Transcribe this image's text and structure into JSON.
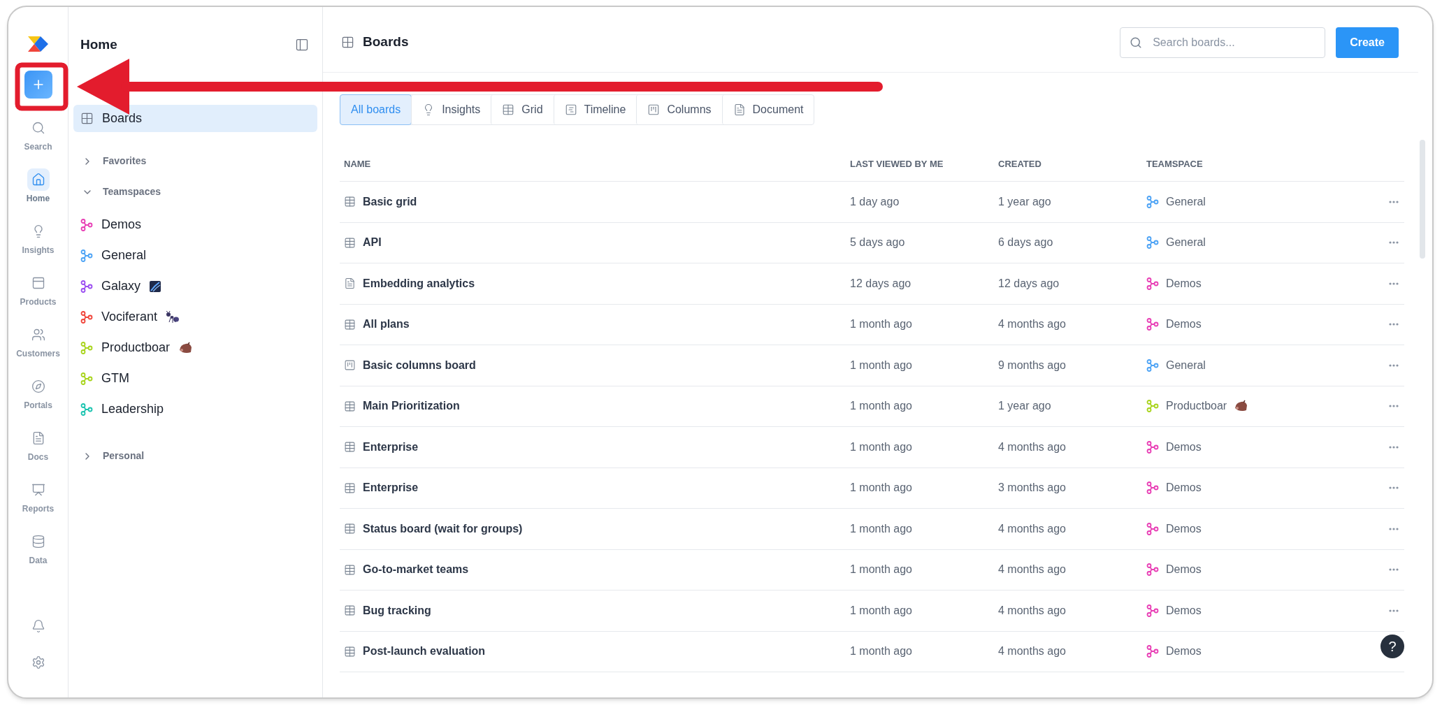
{
  "rail": {
    "items": [
      {
        "kind": "search",
        "label": "Search",
        "selected": false
      },
      {
        "kind": "home",
        "label": "Home",
        "selected": true
      },
      {
        "kind": "insights",
        "label": "Insights",
        "selected": false
      },
      {
        "kind": "products",
        "label": "Products",
        "selected": false
      },
      {
        "kind": "customers",
        "label": "Customers",
        "selected": false
      },
      {
        "kind": "portals",
        "label": "Portals",
        "selected": false
      },
      {
        "kind": "docs",
        "label": "Docs",
        "selected": false
      },
      {
        "kind": "reports",
        "label": "Reports",
        "selected": false
      },
      {
        "kind": "data",
        "label": "Data",
        "selected": false
      }
    ]
  },
  "sidebar": {
    "title": "Home",
    "items": [
      {
        "label": "Boards",
        "selected": true
      }
    ],
    "sections": [
      {
        "label": "Favorites",
        "expanded": false
      },
      {
        "label": "Teamspaces",
        "expanded": true,
        "children": [
          {
            "label": "Demos",
            "color": "#e83fb5"
          },
          {
            "label": "General",
            "color": "#4da3f5"
          },
          {
            "label": "Galaxy",
            "color": "#9b4df0",
            "kind": "galaxy"
          },
          {
            "label": "Vociferant",
            "color": "#f0453a",
            "kind": "ant"
          },
          {
            "label": "Productboar",
            "color": "#a8d41c",
            "kind": "boar"
          },
          {
            "label": "GTM",
            "color": "#a8d41c"
          },
          {
            "label": "Leadership",
            "color": "#1cc4b0"
          }
        ]
      },
      {
        "label": "Personal",
        "expanded": false
      }
    ]
  },
  "header": {
    "title": "Boards",
    "search": {
      "placeholder": "Search boards..."
    },
    "create_button": "Create"
  },
  "tabs": [
    {
      "kind": "all",
      "label": "All boards",
      "selected": true
    },
    {
      "kind": "insights",
      "label": "Insights",
      "selected": false
    },
    {
      "kind": "grid",
      "label": "Grid",
      "selected": false
    },
    {
      "kind": "timeline",
      "label": "Timeline",
      "selected": false
    },
    {
      "kind": "columns",
      "label": "Columns",
      "selected": false
    },
    {
      "kind": "document",
      "label": "Document",
      "selected": false
    }
  ],
  "table": {
    "columns": [
      "NAME",
      "LAST VIEWED BY ME",
      "CREATED",
      "TEAMSPACE"
    ],
    "rows": [
      {
        "kind": "grid",
        "name": "Basic grid",
        "last_viewed": "1 day ago",
        "created": "1 year ago",
        "teamspace": "General",
        "color": "#4da3f5"
      },
      {
        "kind": "grid",
        "name": "API",
        "last_viewed": "5 days ago",
        "created": "6 days ago",
        "teamspace": "General",
        "color": "#4da3f5"
      },
      {
        "kind": "document",
        "name": "Embedding analytics",
        "last_viewed": "12 days ago",
        "created": "12 days ago",
        "teamspace": "Demos",
        "color": "#e83fb5"
      },
      {
        "kind": "grid",
        "name": "All plans",
        "last_viewed": "1 month ago",
        "created": "4 months ago",
        "teamspace": "Demos",
        "color": "#e83fb5"
      },
      {
        "kind": "columns",
        "name": "Basic columns board",
        "last_viewed": "1 month ago",
        "created": "9 months ago",
        "teamspace": "General",
        "color": "#4da3f5"
      },
      {
        "kind": "grid",
        "name": "Main Prioritization",
        "last_viewed": "1 month ago",
        "created": "1 year ago",
        "teamspace": "Productboar",
        "color": "#a8d41c",
        "badge": {
          "kind": "boar"
        }
      },
      {
        "kind": "grid",
        "name": "Enterprise",
        "last_viewed": "1 month ago",
        "created": "4 months ago",
        "teamspace": "Demos",
        "color": "#e83fb5"
      },
      {
        "kind": "grid",
        "name": "Enterprise",
        "last_viewed": "1 month ago",
        "created": "3 months ago",
        "teamspace": "Demos",
        "color": "#e83fb5"
      },
      {
        "kind": "grid",
        "name": "Status board (wait for groups)",
        "last_viewed": "1 month ago",
        "created": "4 months ago",
        "teamspace": "Demos",
        "color": "#e83fb5"
      },
      {
        "kind": "grid",
        "name": "Go-to-market teams",
        "last_viewed": "1 month ago",
        "created": "4 months ago",
        "teamspace": "Demos",
        "color": "#e83fb5"
      },
      {
        "kind": "grid",
        "name": "Bug tracking",
        "last_viewed": "1 month ago",
        "created": "4 months ago",
        "teamspace": "Demos",
        "color": "#e83fb5"
      },
      {
        "kind": "grid",
        "name": "Post-launch evaluation",
        "last_viewed": "1 month ago",
        "created": "4 months ago",
        "teamspace": "Demos",
        "color": "#e83fb5"
      }
    ]
  },
  "help_button": "?"
}
